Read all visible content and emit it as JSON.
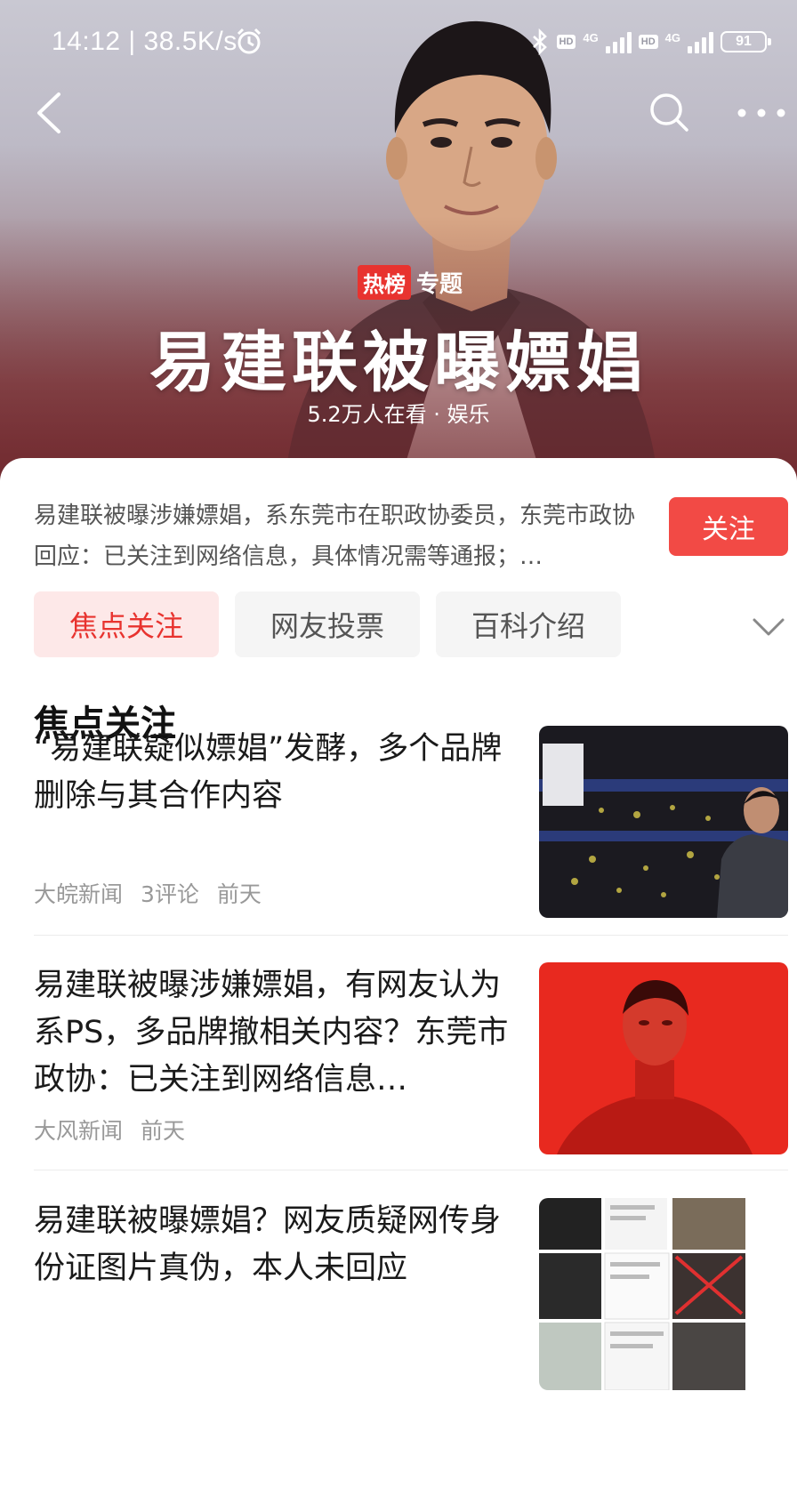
{
  "status_bar": {
    "time": "14:12 | 38.5K/s",
    "network1_label": "4G",
    "network2_label": "4G",
    "hd1": "HD",
    "hd2": "HD",
    "battery": "91",
    "icons": [
      "alarm-icon",
      "bluetooth-icon",
      "signal-icon",
      "battery-icon"
    ]
  },
  "nav": {
    "back_icon": "chevron-left-icon",
    "search_icon": "search-icon",
    "more_icon": "more-dots-icon"
  },
  "hero": {
    "tag_hot": "热榜",
    "tag_topic": "专题",
    "title": "易建联被曝嫖娼",
    "meta": "5.2万人在看 · 娱乐"
  },
  "summary": {
    "text": "易建联被曝涉嫌嫖娼，系东莞市在职政协委员，东莞市政协回应：已关注到网络信息，具体情况需等通报；…",
    "follow_label": "关注"
  },
  "tabs": [
    {
      "label": "焦点关注",
      "active": true
    },
    {
      "label": "网友投票",
      "active": false
    },
    {
      "label": "百科介绍",
      "active": false
    }
  ],
  "section": {
    "title": "焦点关注"
  },
  "articles": [
    {
      "title": "“易建联疑似嫖娼”发酵，多个品牌删除与其合作内容",
      "source": "大皖新闻",
      "comments": "3评论",
      "time": "前天"
    },
    {
      "title": "易建联被曝涉嫌嫖娼，有网友认为系PS，多品牌撤相关内容？东莞市政协：已关注到网络信息…",
      "source": "大风新闻",
      "time": "前天"
    },
    {
      "title": "易建联被曝嫖娼？网友质疑网传身份证图片真伪，本人未回应",
      "source": "",
      "time": ""
    }
  ],
  "colors": {
    "accent": "#e8332f",
    "follow_bg": "#f24a45",
    "active_tab_bg": "#fde8e8"
  }
}
